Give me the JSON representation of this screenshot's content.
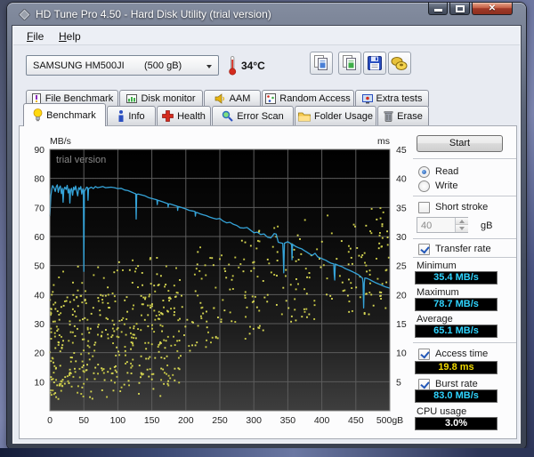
{
  "window": {
    "title": "HD Tune Pro 4.50 - Hard Disk Utility (trial version)"
  },
  "menu": {
    "items": [
      {
        "label": "File"
      },
      {
        "label": "Help"
      }
    ]
  },
  "toolbar": {
    "drive": {
      "name": "SAMSUNG HM500JI",
      "capacity": "(500 gB)"
    },
    "temperature": "34°C"
  },
  "tabs": {
    "row1": [
      {
        "label": "File Benchmark"
      },
      {
        "label": "Disk monitor"
      },
      {
        "label": "AAM"
      },
      {
        "label": "Random Access"
      },
      {
        "label": "Extra tests"
      }
    ],
    "row2": [
      {
        "label": "Benchmark",
        "active": true
      },
      {
        "label": "Info"
      },
      {
        "label": "Health"
      },
      {
        "label": "Error Scan"
      },
      {
        "label": "Folder Usage"
      },
      {
        "label": "Erase"
      }
    ]
  },
  "controls": {
    "start": "Start",
    "read": {
      "label": "Read",
      "selected": true
    },
    "write": {
      "label": "Write",
      "selected": false
    },
    "short_stroke": {
      "label": "Short stroke",
      "checked": false,
      "value": "40",
      "unit": "gB"
    },
    "transfer_rate": {
      "label": "Transfer rate",
      "checked": true
    },
    "minimum": {
      "label": "Minimum",
      "value": "35.4 MB/s"
    },
    "maximum": {
      "label": "Maximum",
      "value": "78.7 MB/s"
    },
    "average": {
      "label": "Average",
      "value": "65.1 MB/s"
    },
    "access_time": {
      "label": "Access time",
      "checked": true,
      "value": "19.8 ms"
    },
    "burst_rate": {
      "label": "Burst rate",
      "checked": true,
      "value": "83.0 MB/s"
    },
    "cpu_usage": {
      "label": "CPU usage",
      "value": "3.0%"
    }
  },
  "chart_data": {
    "type": "line+scatter",
    "watermark": "trial version",
    "y_left": {
      "label": "MB/s",
      "ticks": [
        90,
        80,
        70,
        60,
        50,
        40,
        30,
        20,
        10
      ],
      "min": 0,
      "max": 90
    },
    "y_right": {
      "label": "ms",
      "ticks": [
        45,
        40,
        35,
        30,
        25,
        20,
        15,
        10,
        5
      ],
      "min": 0,
      "max": 45
    },
    "x": {
      "tick_labels": [
        "0",
        "50",
        "100",
        "150",
        "200",
        "250",
        "300",
        "350",
        "400",
        "450",
        "500gB"
      ],
      "min": 0,
      "max": 500
    },
    "line_color": "#35a3d8",
    "dot_color": "#d8d855",
    "grid_color": "#5c5c5c",
    "transfer_rate_series": [
      [
        0,
        67
      ],
      [
        1.5,
        74
      ],
      [
        3,
        76.5
      ],
      [
        4,
        77.5
      ],
      [
        6,
        76.8
      ],
      [
        8,
        75.5
      ],
      [
        9.5,
        77.2
      ],
      [
        11,
        77.8
      ],
      [
        12.5,
        75.2
      ],
      [
        14,
        76.8
      ],
      [
        15.5,
        77.4
      ],
      [
        17,
        74.8
      ],
      [
        18.5,
        76.6
      ],
      [
        19.5,
        71.8
      ],
      [
        20.5,
        76
      ],
      [
        22,
        77
      ],
      [
        24,
        76.2
      ],
      [
        25.5,
        77.6
      ],
      [
        27,
        75
      ],
      [
        28.5,
        76.4
      ],
      [
        29.5,
        71.5
      ],
      [
        30.5,
        75.8
      ],
      [
        32,
        76.6
      ],
      [
        33.5,
        74.2
      ],
      [
        35,
        77
      ],
      [
        36.5,
        76
      ],
      [
        38,
        77.4
      ],
      [
        39.5,
        75.6
      ],
      [
        41,
        74
      ],
      [
        42.5,
        76.8
      ],
      [
        44,
        76.2
      ],
      [
        45.5,
        77.2
      ],
      [
        47,
        74.6
      ],
      [
        48.5,
        76.4
      ],
      [
        49.4,
        75.8
      ],
      [
        50,
        48
      ],
      [
        50.8,
        75.5
      ],
      [
        52,
        76
      ],
      [
        54,
        77
      ],
      [
        55.5,
        76.8
      ],
      [
        56.2,
        72.5
      ],
      [
        57,
        76.5
      ],
      [
        58,
        76.6
      ],
      [
        61,
        77
      ],
      [
        64,
        76.5
      ],
      [
        67,
        77.2
      ],
      [
        70,
        76.8
      ],
      [
        74,
        77
      ],
      [
        78,
        77.2
      ],
      [
        82,
        76.8
      ],
      [
        86,
        76.9
      ],
      [
        90,
        77
      ],
      [
        95,
        76.8
      ],
      [
        100,
        76.5
      ],
      [
        105,
        76.6
      ],
      [
        110,
        76
      ],
      [
        115,
        75.8
      ],
      [
        120,
        75.3
      ],
      [
        124,
        74.9
      ],
      [
        126.3,
        74.7
      ],
      [
        127,
        66
      ],
      [
        127.7,
        74.5
      ],
      [
        130,
        74.6
      ],
      [
        135,
        74.3
      ],
      [
        140,
        74
      ],
      [
        145,
        73.4
      ],
      [
        150,
        73.1
      ],
      [
        155,
        72.8
      ],
      [
        157.5,
        72.6
      ],
      [
        158,
        71
      ],
      [
        158.7,
        72.5
      ],
      [
        160,
        72.4
      ],
      [
        165,
        72
      ],
      [
        170,
        71.6
      ],
      [
        173.5,
        71.3
      ],
      [
        174,
        70.1
      ],
      [
        174.8,
        71.2
      ],
      [
        177,
        71.2
      ],
      [
        180,
        71
      ],
      [
        185,
        70.6
      ],
      [
        187.5,
        70.4
      ],
      [
        188,
        69
      ],
      [
        188.8,
        70.3
      ],
      [
        191,
        70.2
      ],
      [
        195,
        69.9
      ],
      [
        200,
        69.5
      ],
      [
        205,
        69
      ],
      [
        210,
        68.8
      ],
      [
        213.5,
        68.6
      ],
      [
        214,
        67
      ],
      [
        214.8,
        68.3
      ],
      [
        217,
        68.2
      ],
      [
        220,
        67.9
      ],
      [
        225,
        67.5
      ],
      [
        230,
        67.2
      ],
      [
        235,
        66.7
      ],
      [
        240,
        66.3
      ],
      [
        245,
        66
      ],
      [
        250,
        66.2
      ],
      [
        255,
        65.3
      ],
      [
        260,
        64.7
      ],
      [
        265,
        64.9
      ],
      [
        270,
        64.2
      ],
      [
        275,
        63.8
      ],
      [
        280,
        63
      ],
      [
        285,
        62.9
      ],
      [
        290,
        63.1
      ],
      [
        295,
        62.2
      ],
      [
        300,
        61.3
      ],
      [
        305,
        61.5
      ],
      [
        310,
        60.7
      ],
      [
        315,
        60.9
      ],
      [
        320,
        59.8
      ],
      [
        325,
        59.5
      ],
      [
        330,
        61
      ],
      [
        333,
        60.8
      ],
      [
        336,
        58
      ],
      [
        340,
        57.8
      ],
      [
        342.5,
        57.6
      ],
      [
        343.2,
        54
      ],
      [
        344,
        47.5
      ],
      [
        345,
        57.7
      ],
      [
        350,
        58.2
      ],
      [
        354,
        57.6
      ],
      [
        355.5,
        57.4
      ],
      [
        356.2,
        52
      ],
      [
        357,
        57.3
      ],
      [
        362,
        56.5
      ],
      [
        366,
        56.1
      ],
      [
        370,
        55.8
      ],
      [
        374,
        55.2
      ],
      [
        378,
        54.6
      ],
      [
        382,
        54
      ],
      [
        386,
        53.5
      ],
      [
        390,
        54.2
      ],
      [
        394,
        53
      ],
      [
        398,
        52.6
      ],
      [
        402,
        52.2
      ],
      [
        406,
        51.8
      ],
      [
        410,
        51.2
      ],
      [
        414,
        50.8
      ],
      [
        417.5,
        50.6
      ],
      [
        418.2,
        47
      ],
      [
        419,
        45
      ],
      [
        419.8,
        50.5
      ],
      [
        421,
        50.4
      ],
      [
        425,
        50
      ],
      [
        430,
        49.6
      ],
      [
        434,
        49
      ],
      [
        438,
        48.6
      ],
      [
        442,
        48.2
      ],
      [
        446,
        47.8
      ],
      [
        450,
        47.3
      ],
      [
        454,
        46.8
      ],
      [
        458,
        46
      ],
      [
        459.8,
        45.6
      ],
      [
        460.6,
        44
      ],
      [
        461.5,
        35.4
      ],
      [
        462.4,
        44
      ],
      [
        463.2,
        45.7
      ],
      [
        466,
        45.6
      ],
      [
        470,
        45.2
      ],
      [
        474,
        44.7
      ],
      [
        478,
        44.2
      ],
      [
        482,
        43.8
      ],
      [
        486,
        43.4
      ],
      [
        490,
        43
      ],
      [
        494,
        42.6
      ],
      [
        500,
        42.2
      ]
    ],
    "access_time_scatter": {
      "count": 680,
      "seed": 987654321,
      "band_ms_low_start": 3,
      "band_ms_low_end": 17,
      "band_ms_high_start": 21,
      "band_ms_high_end": 33
    }
  }
}
